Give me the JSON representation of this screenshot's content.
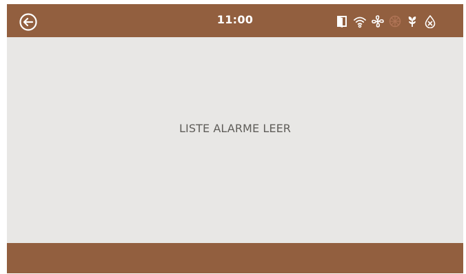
{
  "header": {
    "back_icon": "back-arrow-icon",
    "time": "11:00",
    "status_icons": [
      {
        "name": "door-icon",
        "active": true
      },
      {
        "name": "wifi-icon",
        "active": true
      },
      {
        "name": "fan-icon",
        "active": true
      },
      {
        "name": "heating-icon",
        "active": false
      },
      {
        "name": "plant-icon",
        "active": true
      },
      {
        "name": "water-off-icon",
        "active": true
      }
    ]
  },
  "main": {
    "empty_message": "LISTE ALARME LEER"
  },
  "colors": {
    "bar": "#925f3f",
    "background": "#e8e7e5",
    "text": "#5f5d59",
    "icon_active": "#ffffff",
    "icon_inactive": "#b07456"
  }
}
